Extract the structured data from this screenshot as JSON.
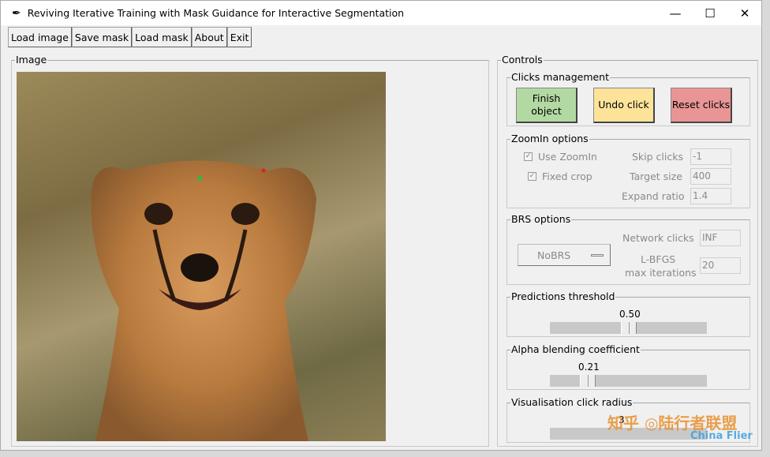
{
  "window": {
    "title": "Reviving Iterative Training with Mask Guidance for Interactive Segmentation",
    "minimize_icon": "minimize",
    "maximize_icon": "maximize",
    "close_icon": "close"
  },
  "menu": [
    "Load image",
    "Save mask",
    "Load mask",
    "About",
    "Exit"
  ],
  "image_panel": {
    "label": "Image",
    "clicks": [
      {
        "type": "positive",
        "color": "#2db84a"
      },
      {
        "type": "negative",
        "color": "#e02020"
      }
    ]
  },
  "controls": {
    "label": "Controls",
    "clicks": {
      "label": "Clicks management",
      "finish": "Finish object",
      "undo": "Undo click",
      "reset": "Reset clicks",
      "colors": {
        "finish": "#b3d9a3",
        "undo": "#fde39a",
        "reset": "#e99595"
      }
    },
    "zoomin": {
      "label": "ZoomIn options",
      "use_zoomin": "Use ZoomIn",
      "use_zoomin_checked": true,
      "fixed_crop": "Fixed crop",
      "fixed_crop_checked": true,
      "skip_clicks_label": "Skip clicks",
      "skip_clicks": "-1",
      "target_size_label": "Target size",
      "target_size": "400",
      "expand_ratio_label": "Expand ratio",
      "expand_ratio": "1.4"
    },
    "brs": {
      "label": "BRS options",
      "mode": "NoBRS",
      "network_clicks_label": "Network clicks",
      "network_clicks": "INF",
      "lbfgs_label_1": "L-BFGS",
      "lbfgs_label_2": "max iterations",
      "lbfgs": "20"
    },
    "threshold": {
      "label": "Predictions threshold",
      "value": "0.50",
      "fraction": 0.5
    },
    "alpha": {
      "label": "Alpha blending coefficient",
      "value": "0.21",
      "fraction": 0.21
    },
    "radius": {
      "label": "Visualisation click radius",
      "value": "3"
    }
  },
  "watermark": "知乎 @陆行者联盟 China Flier"
}
